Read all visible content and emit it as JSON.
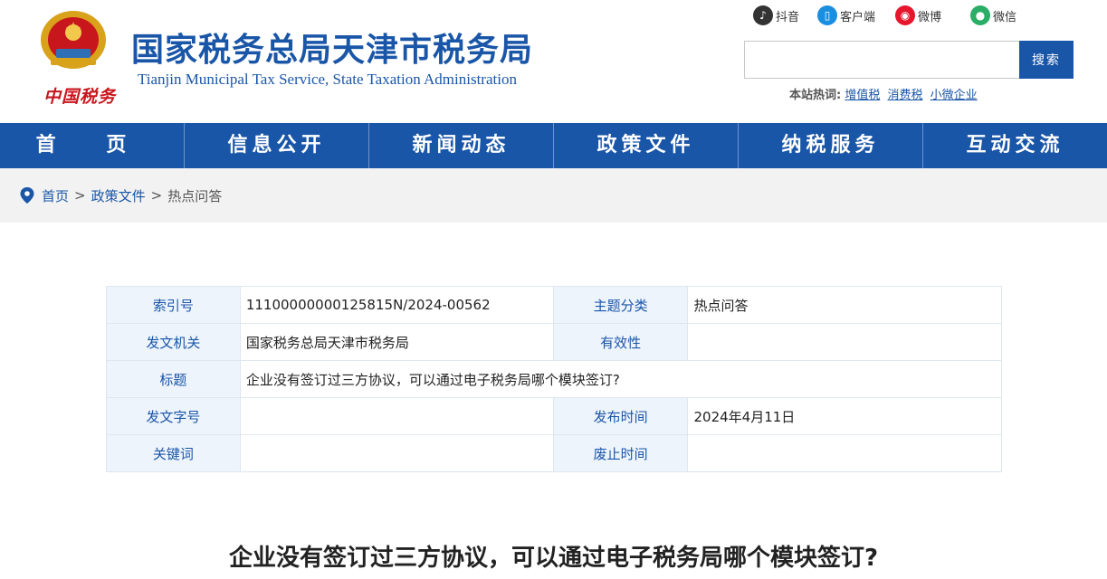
{
  "header": {
    "title": "国家税务总局天津市税务局",
    "subtitle": "Tianjin Municipal Tax Service, State Taxation Administration",
    "slogan": "中国税务"
  },
  "social": [
    {
      "label": "抖音",
      "icon": "douyin-icon",
      "color": "#333333"
    },
    {
      "label": "客户端",
      "icon": "mobile-client-icon",
      "color": "#1a8fe0"
    },
    {
      "label": "微博",
      "icon": "weibo-icon",
      "color": "#e6162d"
    },
    {
      "label": "微信",
      "icon": "wechat-icon",
      "color": "#2aae67"
    }
  ],
  "search": {
    "placeholder": "",
    "button_label": "搜索",
    "hot_label": "本站热词:",
    "hot_words": [
      "增值税",
      "消费税",
      "小微企业"
    ]
  },
  "nav": [
    "首 页",
    "信息公开",
    "新闻动态",
    "政策文件",
    "纳税服务",
    "互动交流"
  ],
  "breadcrumb": {
    "home": "首页",
    "section": "政策文件",
    "current": "热点问答",
    "separator": ">"
  },
  "meta": {
    "index_label": "索引号",
    "index_value": "11100000000125815N/2024-00562",
    "topic_label": "主题分类",
    "topic_value": "热点问答",
    "issuer_label": "发文机关",
    "issuer_value": "国家税务总局天津市税务局",
    "validity_label": "有效性",
    "validity_value": "",
    "title_label": "标题",
    "title_value": "企业没有签订过三方协议，可以通过电子税务局哪个模块签订?",
    "docno_label": "发文字号",
    "docno_value": "",
    "pubdate_label": "发布时间",
    "pubdate_value": "2024年4月11日",
    "keyword_label": "关键词",
    "keyword_value": "",
    "expire_label": "废止时间",
    "expire_value": ""
  },
  "article": {
    "title": "企业没有签订过三方协议，可以通过电子税务局哪个模块签订?"
  },
  "colors": {
    "brand_blue": "#1a56a8",
    "accent_red": "#c8161d",
    "label_bg": "#eef4fc"
  }
}
